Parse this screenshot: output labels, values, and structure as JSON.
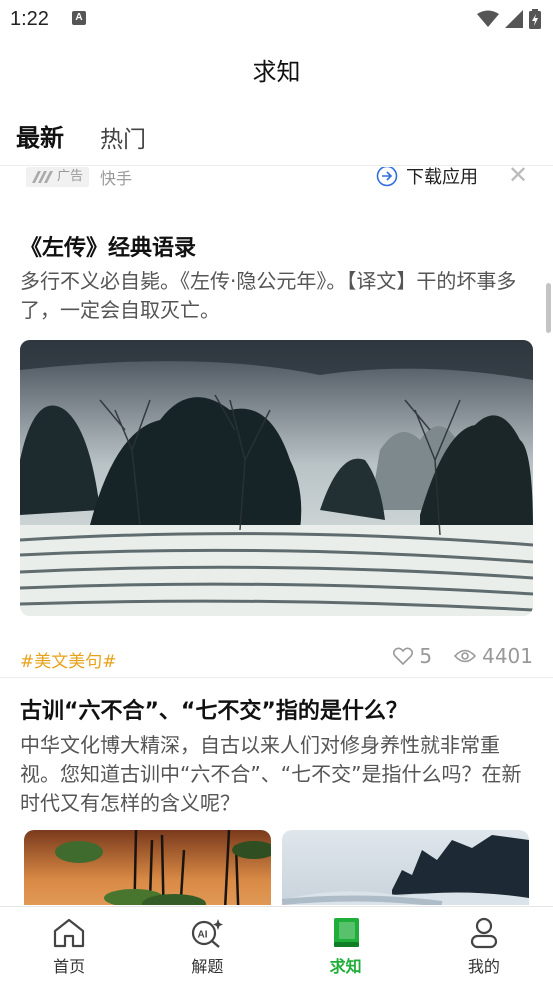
{
  "status_bar": {
    "time": "1:22",
    "notification_badge": "A"
  },
  "header": {
    "title": "求知"
  },
  "tabs": [
    {
      "label": "最新",
      "active": true
    },
    {
      "label": "热门",
      "active": false
    }
  ],
  "ad": {
    "badge": "广告",
    "source": "快手",
    "download_label": "下载应用"
  },
  "articles": [
    {
      "title": "《左传》经典语录",
      "summary": "多行不义必自毙。《左传·隐公元年》。【译文】干的坏事多了，一定会自取灭亡。",
      "tag": "#美文美句#",
      "likes": "5",
      "views": "4401"
    },
    {
      "title": "古训“六不合”、“七不交”指的是什么？",
      "summary": "中华文化博大精深，自古以来人们对修身养性就非常重视。您知道古训中“六不合”、“七不交”是指什么吗？在新时代又有怎样的含义呢？"
    }
  ],
  "bottom_nav": [
    {
      "label": "首页",
      "icon": "home-icon",
      "active": false
    },
    {
      "label": "解题",
      "icon": "ai-search-icon",
      "active": false
    },
    {
      "label": "求知",
      "icon": "book-icon",
      "active": true
    },
    {
      "label": "我的",
      "icon": "profile-icon",
      "active": false
    }
  ],
  "colors": {
    "accent": "#1fae3a",
    "tag": "#e8a21b",
    "tab_highlight": "#7fd27f"
  }
}
